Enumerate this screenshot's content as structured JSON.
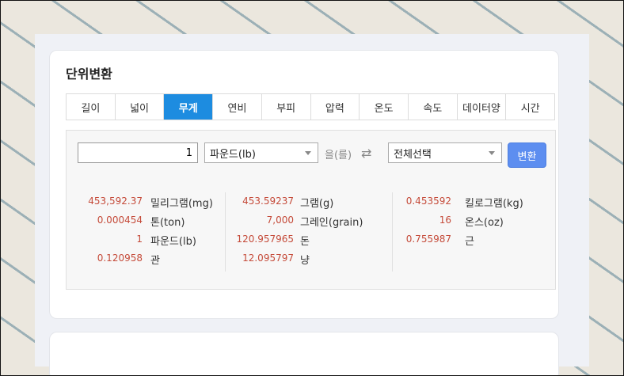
{
  "card": {
    "title": "단위변환"
  },
  "tabs": [
    {
      "label": "길이"
    },
    {
      "label": "넓이"
    },
    {
      "label": "무게"
    },
    {
      "label": "연비"
    },
    {
      "label": "부피"
    },
    {
      "label": "압력"
    },
    {
      "label": "온도"
    },
    {
      "label": "속도"
    },
    {
      "label": "데이터양"
    },
    {
      "label": "시간"
    }
  ],
  "active_tab": "무게",
  "converter": {
    "input_value": "1",
    "from_unit": "파운드(lb)",
    "josa": "을(를)",
    "swap_icon": "⇄",
    "to_unit": "전체선택",
    "convert_label": "변환"
  },
  "results": [
    [
      {
        "value": "453,592.37",
        "unit": "밀리그램(mg)"
      },
      {
        "value": "0.000454",
        "unit": "톤(ton)"
      },
      {
        "value": "1",
        "unit": "파운드(lb)"
      },
      {
        "value": "0.120958",
        "unit": "관"
      }
    ],
    [
      {
        "value": "453.59237",
        "unit": "그램(g)"
      },
      {
        "value": "7,000",
        "unit": "그레인(grain)"
      },
      {
        "value": "120.957965",
        "unit": "돈"
      },
      {
        "value": "12.095797",
        "unit": "냥"
      }
    ],
    [
      {
        "value": "0.453592",
        "unit": "킬로그램(kg)"
      },
      {
        "value": "16",
        "unit": "온스(oz)"
      },
      {
        "value": "0.755987",
        "unit": "근"
      }
    ]
  ],
  "colors": {
    "accent": "#1d8ce0",
    "button": "#5d8ef0",
    "value": "#c54b3a"
  }
}
